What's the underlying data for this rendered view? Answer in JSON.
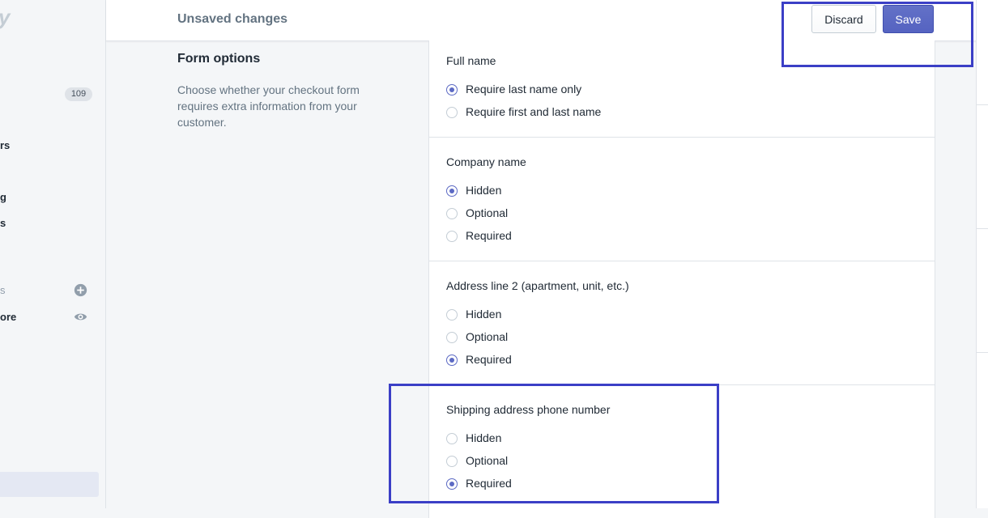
{
  "sidebar": {
    "logo_fragment": "y",
    "badge_count": "109",
    "nav_fragments": [
      "rs",
      "g",
      "s",
      "s",
      "ore"
    ]
  },
  "topbar": {
    "title": "Unsaved changes",
    "discard_label": "Discard",
    "save_label": "Save"
  },
  "section": {
    "title": "Form options",
    "description": "Choose whether your checkout form requires extra information from your customer."
  },
  "groups": [
    {
      "label": "Full name",
      "options": [
        {
          "label": "Require last name only",
          "checked": true
        },
        {
          "label": "Require first and last name",
          "checked": false
        }
      ]
    },
    {
      "label": "Company name",
      "options": [
        {
          "label": "Hidden",
          "checked": true
        },
        {
          "label": "Optional",
          "checked": false
        },
        {
          "label": "Required",
          "checked": false
        }
      ]
    },
    {
      "label": "Address line 2 (apartment, unit, etc.)",
      "options": [
        {
          "label": "Hidden",
          "checked": false
        },
        {
          "label": "Optional",
          "checked": false
        },
        {
          "label": "Required",
          "checked": true
        }
      ]
    },
    {
      "label": "Shipping address phone number",
      "options": [
        {
          "label": "Hidden",
          "checked": false
        },
        {
          "label": "Optional",
          "checked": false
        },
        {
          "label": "Required",
          "checked": true
        }
      ]
    }
  ],
  "colors": {
    "accent": "#5c6ac4",
    "highlight": "#3b3fc6"
  }
}
